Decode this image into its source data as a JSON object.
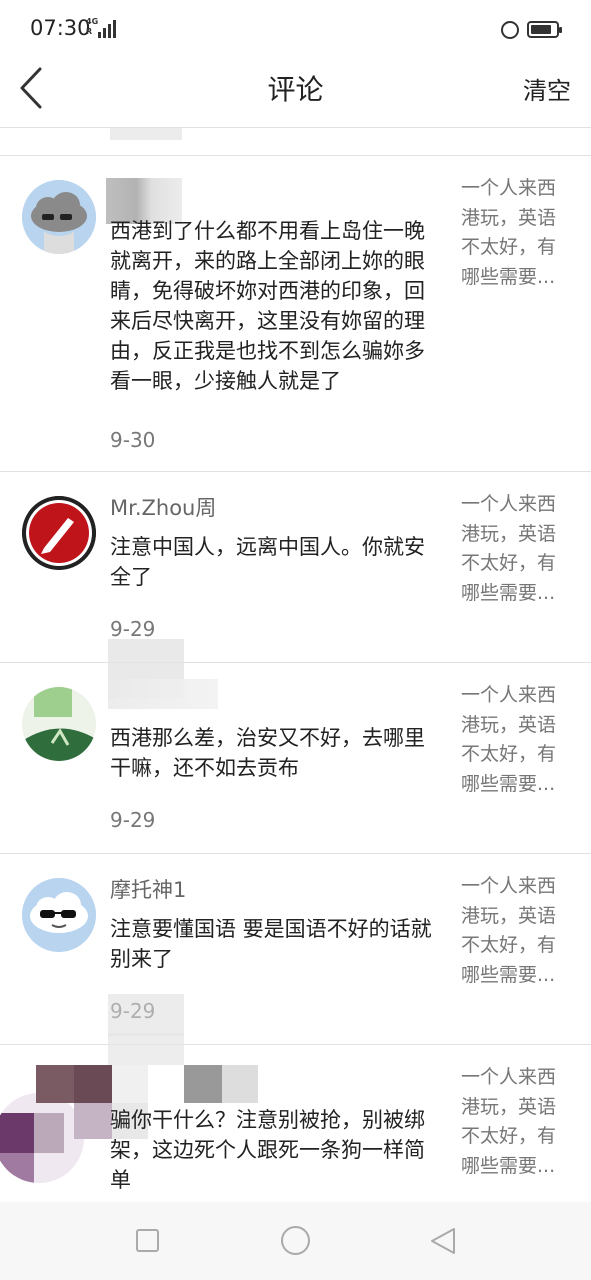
{
  "status_bar": {
    "time": "07:30",
    "network_top": "4G",
    "network_bottom": "R",
    "battery_level": 0.85
  },
  "nav": {
    "back_icon": "chevron-left-icon",
    "title": "评论",
    "clear_label": "清空"
  },
  "partial_item": {
    "date": "9-30"
  },
  "comments": [
    {
      "username": "",
      "content": "西港到了什么都不用看上岛住一晚就离开，来的路上全部闭上妳的眼睛，免得破坏妳对西港的印象，回来后尽快离开，这里没有妳留的理由，反正我是也找不到怎么骗妳多看一眼，少接触人就是了",
      "date": "9-30",
      "post_lines": [
        "一个人来西",
        "港玩，英语",
        "不太好，有",
        "哪些需要..."
      ]
    },
    {
      "username": "Mr.Zhou周",
      "content": "注意中国人，远离中国人。你就安全了",
      "date": "9-29",
      "post_lines": [
        "一个人来西",
        "港玩，英语",
        "不太好，有",
        "哪些需要..."
      ]
    },
    {
      "username": "",
      "content": "西港那么差，治安又不好，去哪里干嘛，还不如去贡布",
      "date": "9-29",
      "post_lines": [
        "一个人来西",
        "港玩，英语",
        "不太好，有",
        "哪些需要..."
      ]
    },
    {
      "username": "摩托神1",
      "content": "注意要懂国语 要是国语不好的话就别来了",
      "date": "9-29",
      "post_lines": [
        "一个人来西",
        "港玩，英语",
        "不太好，有",
        "哪些需要..."
      ]
    },
    {
      "username": "",
      "content": "骗你干什么？注意别被抢，别被绑架，这边死个人跟死一条狗一样简单",
      "date": "",
      "post_lines": [
        "一个人来西",
        "港玩，英语",
        "不太好，有",
        "哪些需要..."
      ]
    }
  ],
  "bottom_nav": {
    "recent_icon": "square-icon",
    "home_icon": "circle-icon",
    "back_icon": "triangle-back-icon"
  }
}
